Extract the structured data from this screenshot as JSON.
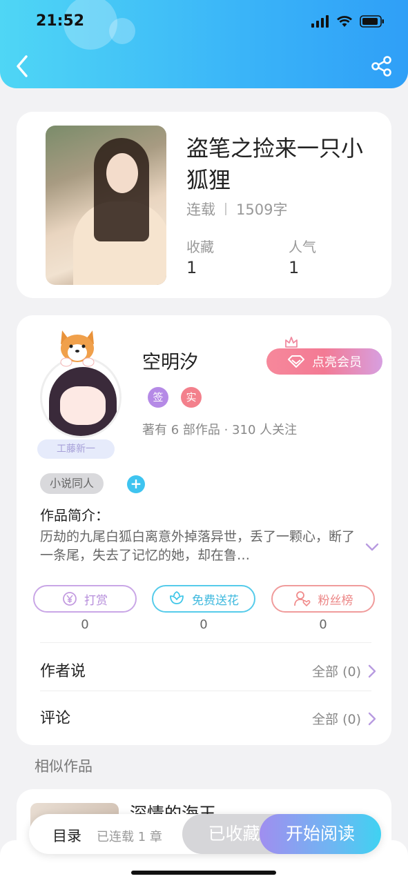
{
  "status_bar": {
    "time": "21:52"
  },
  "book": {
    "title": "盗笔之捡来一只小狐狸",
    "status": "连载",
    "word_count": "1509字",
    "favorites_label": "收藏",
    "favorites_value": "1",
    "popularity_label": "人气",
    "popularity_value": "1"
  },
  "author": {
    "name": "空明汐",
    "avatar_badge": "工藤新一",
    "tag_signed": "签",
    "tag_verified": "实",
    "stats": "著有 6 部作品 · 310 人关注",
    "vip_button": "点亮会员"
  },
  "genre_tag": "小说同人",
  "plus": "+",
  "intro": {
    "label": "作品简介：",
    "text": "历劫的九尾白狐白离意外掉落异世，丢了一颗心，断了一条尾，失去了记忆的她，却在鲁…"
  },
  "actions": [
    {
      "label": "打赏",
      "count": "0",
      "icon": "yen-icon",
      "color": "#c39be0"
    },
    {
      "label": "免费送花",
      "count": "0",
      "icon": "flower-icon",
      "color": "#3fc6e8"
    },
    {
      "label": "粉丝榜",
      "count": "0",
      "icon": "fan-icon",
      "color": "#f08b8b"
    }
  ],
  "rows": {
    "author_says": {
      "label": "作者说",
      "right": "全部 (0)"
    },
    "comments": {
      "label": "评论",
      "right": "全部 (0)"
    }
  },
  "similar": {
    "label": "相似作品",
    "first_title": "深情的海王"
  },
  "bottom_bar": {
    "toc": "目录",
    "chapters": "已连载 1 章",
    "favorited": "已收藏",
    "start_reading": "开始阅读"
  },
  "colors": {
    "header_gradient": [
      "#4fd6f5",
      "#2f9ff7"
    ],
    "vip_gradient": [
      "#f6889b",
      "#d79fe0"
    ],
    "read_gradient": [
      "#a08ef0",
      "#3fd2f2"
    ]
  }
}
